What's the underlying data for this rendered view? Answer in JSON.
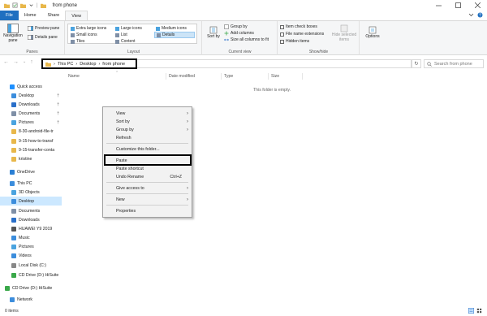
{
  "window": {
    "title": "from phone",
    "controls": [
      "minimize",
      "maximize",
      "close"
    ]
  },
  "ribbon_tabs": [
    "File",
    "Home",
    "Share",
    "View"
  ],
  "ribbon": {
    "panes": {
      "label": "Panes",
      "navigation_pane": "Navigation pane",
      "preview_pane": "Preview pane",
      "details_pane": "Details pane"
    },
    "layout": {
      "label": "Layout",
      "items": [
        "Extra large icons",
        "Large icons",
        "Medium icons",
        "Small icons",
        "List",
        "Details",
        "Tiles",
        "Content"
      ],
      "selected": "Details"
    },
    "current_view": {
      "label": "Current view",
      "sort_by": "Sort by",
      "group_by": "Group by",
      "add_columns": "Add columns",
      "size_all_columns": "Size all columns to fit"
    },
    "show_hide": {
      "label": "Show/hide",
      "item_check_boxes": "Item check boxes",
      "file_name_extensions": "File name extensions",
      "hidden_items": "Hidden items",
      "hide_selected_items": "Hide selected items"
    },
    "options": "Options"
  },
  "address": {
    "breadcrumb": [
      "This PC",
      "Desktop",
      "from phone"
    ],
    "search_placeholder": "Search from phone"
  },
  "nav_pane": [
    {
      "label": "Quick access",
      "icon": "star-icon",
      "color": "#1e90ff"
    },
    {
      "label": "Desktop",
      "icon": "desktop-icon",
      "color": "#3c8ddc",
      "pin": true
    },
    {
      "label": "Downloads",
      "icon": "download-icon",
      "color": "#2a6fc9",
      "pin": true
    },
    {
      "label": "Documents",
      "icon": "documents-icon",
      "color": "#7f8fa6",
      "pin": true
    },
    {
      "label": "Pictures",
      "icon": "pictures-icon",
      "color": "#4aa3df",
      "pin": true
    },
    {
      "label": "8-30-android-file-tr",
      "icon": "folder-icon",
      "color": "#e8b74a"
    },
    {
      "label": "9-15-how-to-transf",
      "icon": "folder-icon",
      "color": "#e8b74a"
    },
    {
      "label": "9-15-transfer-conta",
      "icon": "folder-icon",
      "color": "#e8b74a"
    },
    {
      "label": "kristine",
      "icon": "folder-icon",
      "color": "#e8b74a"
    },
    {
      "label": "OneDrive",
      "icon": "cloud-icon",
      "color": "#2a7fd4"
    },
    {
      "label": "This PC",
      "icon": "computer-icon",
      "color": "#3c8ddc"
    },
    {
      "label": "3D Objects",
      "icon": "cube-icon",
      "color": "#4aa3df"
    },
    {
      "label": "Desktop",
      "icon": "desktop-icon",
      "color": "#3c8ddc",
      "selected": true
    },
    {
      "label": "Documents",
      "icon": "documents-icon",
      "color": "#7f8fa6"
    },
    {
      "label": "Downloads",
      "icon": "download-icon",
      "color": "#2a6fc9"
    },
    {
      "label": "HUAWEI Y9 2019",
      "icon": "phone-icon",
      "color": "#555555"
    },
    {
      "label": "Music",
      "icon": "music-icon",
      "color": "#3c8ddc"
    },
    {
      "label": "Pictures",
      "icon": "pictures-icon",
      "color": "#4aa3df"
    },
    {
      "label": "Videos",
      "icon": "video-icon",
      "color": "#3c8ddc"
    },
    {
      "label": "Local Disk (C:)",
      "icon": "disk-icon",
      "color": "#888888"
    },
    {
      "label": "CD Drive (D:) HiSuite",
      "icon": "cd-icon",
      "color": "#3aa84a"
    },
    {
      "label": "CD Drive (D:) HiSuite",
      "icon": "cd-icon",
      "color": "#3aa84a"
    },
    {
      "label": "Network",
      "icon": "network-icon",
      "color": "#3c8ddc"
    }
  ],
  "columns": [
    "Name",
    "Date modified",
    "Type",
    "Size"
  ],
  "empty_message": "This folder is empty.",
  "context_menu": {
    "view": "View",
    "sort_by": "Sort by",
    "group_by": "Group by",
    "refresh": "Refresh",
    "customize": "Customize this folder...",
    "paste": "Paste",
    "paste_shortcut": "Paste shortcut",
    "undo_rename": "Undo Rename",
    "undo_shortcut": "Ctrl+Z",
    "give_access": "Give access to",
    "new": "New",
    "properties": "Properties"
  },
  "status": {
    "items": "0 items"
  },
  "colors": {
    "file_tab": "#1f6fc0",
    "selection": "#cce8ff",
    "folder": "#e8b74a"
  }
}
